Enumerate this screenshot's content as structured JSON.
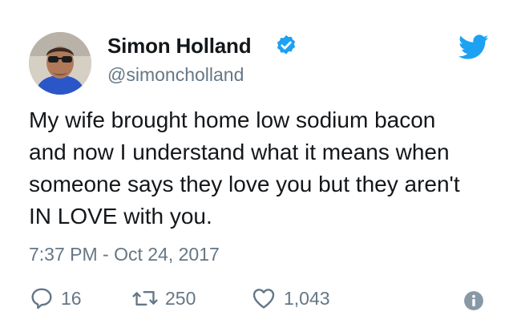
{
  "tweet": {
    "author": {
      "display_name": "Simon Holland",
      "handle": "@simoncholland",
      "verified": true,
      "avatar": "profile-photo"
    },
    "text_lines": [
      "My wife brought home low sodium bacon",
      "and now I understand what it means when",
      "someone says they love you but they aren't",
      "IN LOVE with you."
    ],
    "timestamp": "7:37 PM - Oct 24, 2017",
    "actions": {
      "replies": "16",
      "retweets": "250",
      "likes": "1,043"
    }
  },
  "icons": {
    "verified": "verified-badge-icon",
    "brand": "twitter-bird-icon",
    "reply": "reply-icon",
    "retweet": "retweet-icon",
    "like": "heart-icon",
    "info": "info-icon"
  },
  "colors": {
    "twitter_blue": "#1da1f2",
    "primary_text": "#14171a",
    "secondary_text": "#657786",
    "background": "#ffffff"
  }
}
